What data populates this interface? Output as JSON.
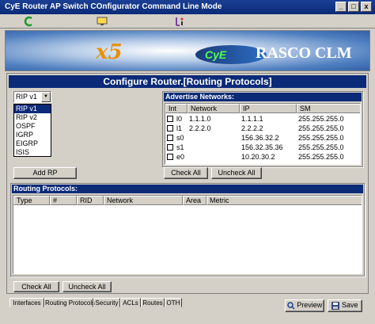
{
  "window": {
    "title": "CyE Router AP Switch COnfigurator Command Line Mode",
    "controls": [
      "_",
      "□",
      "x"
    ]
  },
  "banner": {
    "logo_mark": "x5",
    "brand_small": "CyE",
    "brand": "RASCO CLM"
  },
  "page": {
    "header": "Configure Router.[Routing Protocols]"
  },
  "protocol_select": {
    "selected": "RIP v1",
    "options": [
      "RIP v1",
      "RIP v2",
      "OSPF",
      "IGRP",
      "EIGRP",
      "ISIS"
    ]
  },
  "buttons": {
    "add_rp": "Add RP",
    "check_all_adv": "Check All",
    "uncheck_all_adv": "Uncheck All",
    "check_all_rp": "Check All",
    "uncheck_all_rp": "Uncheck All",
    "preview": "Preview",
    "save": "Save"
  },
  "advertise": {
    "title": "Advertise Networks:",
    "columns": [
      "Int",
      "Network",
      "IP",
      "SM"
    ],
    "rows": [
      {
        "int": "l0",
        "network": "1.1.1.0",
        "ip": "1.1.1.1",
        "sm": "255.255.255.0"
      },
      {
        "int": "l1",
        "network": "2.2.2.0",
        "ip": "2.2.2.2",
        "sm": "255.255.255.0"
      },
      {
        "int": "s0",
        "network": "",
        "ip": "156.36.32.2",
        "sm": "255.255.255.0"
      },
      {
        "int": "s1",
        "network": "",
        "ip": "156.32.35.36",
        "sm": "255.255.255.0"
      },
      {
        "int": "e0",
        "network": "",
        "ip": "10.20.30.2",
        "sm": "255.255.255.0"
      }
    ]
  },
  "routing": {
    "title": "Routing Protocols:",
    "columns": [
      "Type",
      "#",
      "RID",
      "Network",
      "Area",
      "Metric"
    ]
  },
  "tabs": [
    "Interfaces",
    "Routing Protocols",
    "Security",
    "ACLs",
    "Routes",
    "OTH"
  ],
  "active_tab": "Routing Protocols",
  "colors": {
    "title_bar": "#0b2a78",
    "face": "#d4d0c8",
    "brand_orange": "#e8900a",
    "brand_green": "#50ff50"
  }
}
